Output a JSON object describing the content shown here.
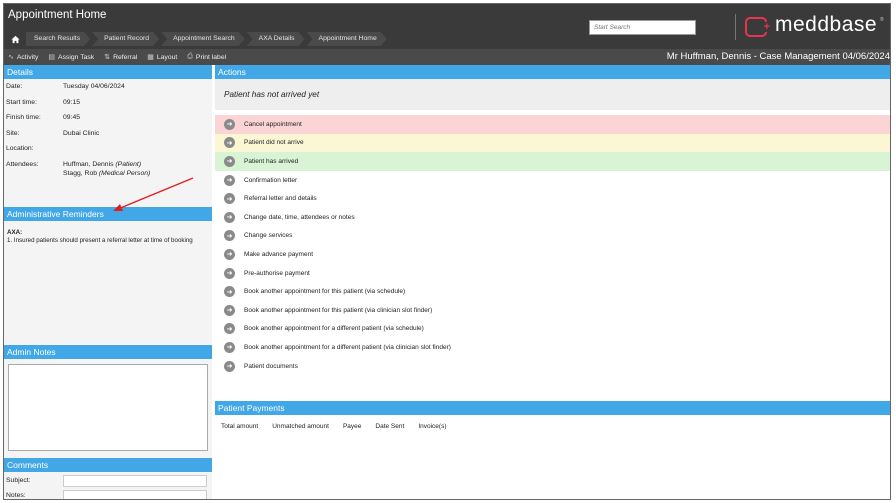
{
  "app": {
    "title": "Appointment Home",
    "logo_text": "meddbase",
    "logo_mark": "®"
  },
  "breadcrumbs": [
    {
      "label": "Search Results"
    },
    {
      "label": "Patient Record"
    },
    {
      "label": "Appointment Search"
    },
    {
      "label": "AXA Details"
    },
    {
      "label": "Appointment Home"
    }
  ],
  "search": {
    "placeholder": "Start Search"
  },
  "toolbar": {
    "items": [
      {
        "label": "Activity",
        "icon": "activity-icon"
      },
      {
        "label": "Assign Task",
        "icon": "task-icon"
      },
      {
        "label": "Referral",
        "icon": "referral-icon"
      },
      {
        "label": "Layout",
        "icon": "layout-icon"
      },
      {
        "label": "Print label",
        "icon": "print-icon"
      }
    ],
    "title": "Mr Huffman, Dennis - Case Management 04/06/2024"
  },
  "details": {
    "heading": "Details",
    "date_label": "Date:",
    "date_value": "Tuesday 04/06/2024",
    "start_label": "Start time:",
    "start_value": "09:15",
    "finish_label": "Finish time:",
    "finish_value": "09:45",
    "site_label": "Site:",
    "site_value": "Dubai Clinic",
    "location_label": "Location:",
    "location_value": "",
    "attendees_label": "Attendees:",
    "attendee1_name": "Huffman, Dennis",
    "attendee1_role": "(Patient)",
    "attendee2_name": "Stagg, Rob",
    "attendee2_role": "(Medical Person)"
  },
  "reminders": {
    "heading": "Administrative Reminders",
    "insurer": "AXA:",
    "text": "1. Insured patients should present a referral letter at time of booking"
  },
  "admin_notes": {
    "heading": "Admin Notes",
    "value": ""
  },
  "comments": {
    "heading": "Comments",
    "subject_label": "Subject:",
    "notes_label": "Notes:"
  },
  "actions": {
    "heading": "Actions",
    "status": "Patient has not arrived yet",
    "items": [
      {
        "label": "Cancel appointment"
      },
      {
        "label": "Patient did not arrive"
      },
      {
        "label": "Patient has arrived"
      },
      {
        "label": "Confirmation letter"
      },
      {
        "label": "Referral letter and details"
      },
      {
        "label": "Change date, time, attendees or notes"
      },
      {
        "label": "Change services"
      },
      {
        "label": "Make advance payment"
      },
      {
        "label": "Pre-authorise payment"
      },
      {
        "label": "Book another appointment for this patient (via schedule)"
      },
      {
        "label": "Book another appointment for this patient (via clinician slot finder)"
      },
      {
        "label": "Book another appointment for a different patient (via schedule)"
      },
      {
        "label": "Book another appointment for a different patient (via clinician slot finder)"
      },
      {
        "label": "Patient documents"
      }
    ]
  },
  "payments": {
    "heading": "Patient Payments",
    "columns": [
      "Total amount",
      "Unmatched amount",
      "Payee",
      "Date Sent",
      "Invoice(s)"
    ]
  },
  "colors": {
    "header_bg": "#3a3a3a",
    "section_blue": "#41a7e6",
    "logo_red": "#e8344e",
    "cancel_bg": "#fbd5d5",
    "no_show_bg": "#fbf7d5",
    "arrived_bg": "#d9f4d5",
    "annotation_arrow": "#e02020"
  }
}
